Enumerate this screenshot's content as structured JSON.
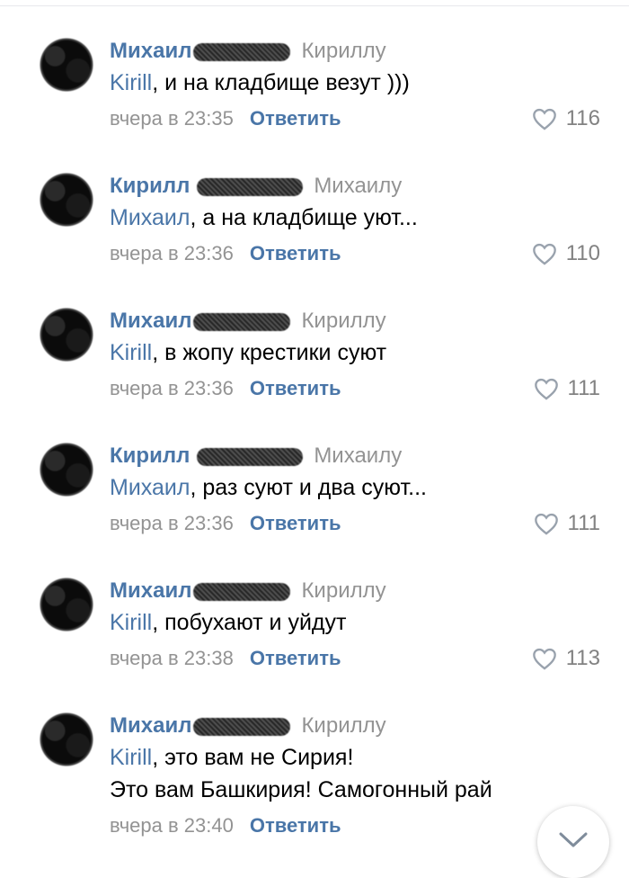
{
  "comments": [
    {
      "author": "Михаил",
      "reply_to": "Кириллу",
      "mention": "Kirill",
      "text": ", и на кладбище везут )))",
      "extra_text": "",
      "date": "вчера в 23:35",
      "reply_label": "Ответить",
      "likes": "116"
    },
    {
      "author": "Кирилл",
      "reply_to": "Михаилу",
      "mention": "Михаил",
      "text": ", а на кладбище уют...",
      "extra_text": "",
      "date": "вчера в 23:36",
      "reply_label": "Ответить",
      "likes": "110"
    },
    {
      "author": "Михаил",
      "reply_to": "Кириллу",
      "mention": "Kirill",
      "text": ", в жопу крестики суют",
      "extra_text": "",
      "date": "вчера в 23:36",
      "reply_label": "Ответить",
      "likes": "111"
    },
    {
      "author": "Кирилл",
      "reply_to": "Михаилу",
      "mention": "Михаил",
      "text": ", раз суют и два суют...",
      "extra_text": "",
      "date": "вчера в 23:36",
      "reply_label": "Ответить",
      "likes": "111"
    },
    {
      "author": "Михаил",
      "reply_to": "Кириллу",
      "mention": "Kirill",
      "text": ", побухают и уйдут",
      "extra_text": "",
      "date": "вчера в 23:38",
      "reply_label": "Ответить",
      "likes": "113"
    },
    {
      "author": "Михаил",
      "reply_to": "Кириллу",
      "mention": "Kirill",
      "text": ", это вам не Сирия!",
      "extra_text": "Это вам Башкирия! Самогонный рай",
      "date": "вчера в 23:40",
      "reply_label": "Ответить",
      "likes": ""
    }
  ],
  "icons": {
    "like": "heart-icon",
    "scroll": "chevron-down-icon"
  },
  "colors": {
    "link": "#4a76a8",
    "muted": "#939393",
    "text": "#000000"
  }
}
